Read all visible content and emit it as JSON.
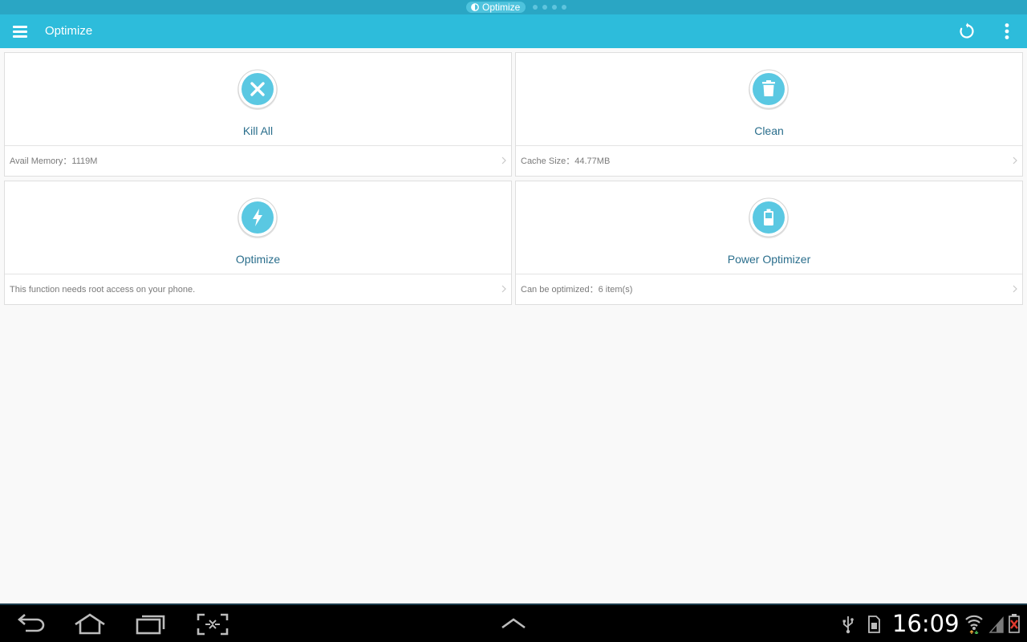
{
  "status_bar": {
    "pill_label": "Optimize"
  },
  "action_bar": {
    "title": "Optimize",
    "icons": [
      "menu-icon",
      "refresh-icon",
      "overflow-menu-icon"
    ]
  },
  "cards": [
    {
      "label": "Kill All",
      "info": "Avail Memory：1119M",
      "icon": "close-x-icon"
    },
    {
      "label": "Clean",
      "info": "Cache Size：44.77MB",
      "icon": "trash-icon"
    },
    {
      "label": "Optimize",
      "info": "This function needs root access on your phone.",
      "icon": "lightning-icon"
    },
    {
      "label": "Power Optimizer",
      "info": "Can be optimized：6 item(s)",
      "icon": "battery-icon"
    }
  ],
  "system_bar": {
    "clock": "16:09",
    "nav_icons": [
      "back-icon",
      "home-icon",
      "recent-apps-icon",
      "screenshot-icon",
      "expand-up-icon"
    ],
    "tray_icons": [
      "usb-icon",
      "sd-card-icon",
      "wifi-icon",
      "signal-icon",
      "battery-low-icon"
    ]
  },
  "colors": {
    "accent": "#2dbcdb",
    "status_strip": "#2aa6c4",
    "card_label": "#2a6e8c",
    "icon_circle": "#5ac8e2"
  }
}
